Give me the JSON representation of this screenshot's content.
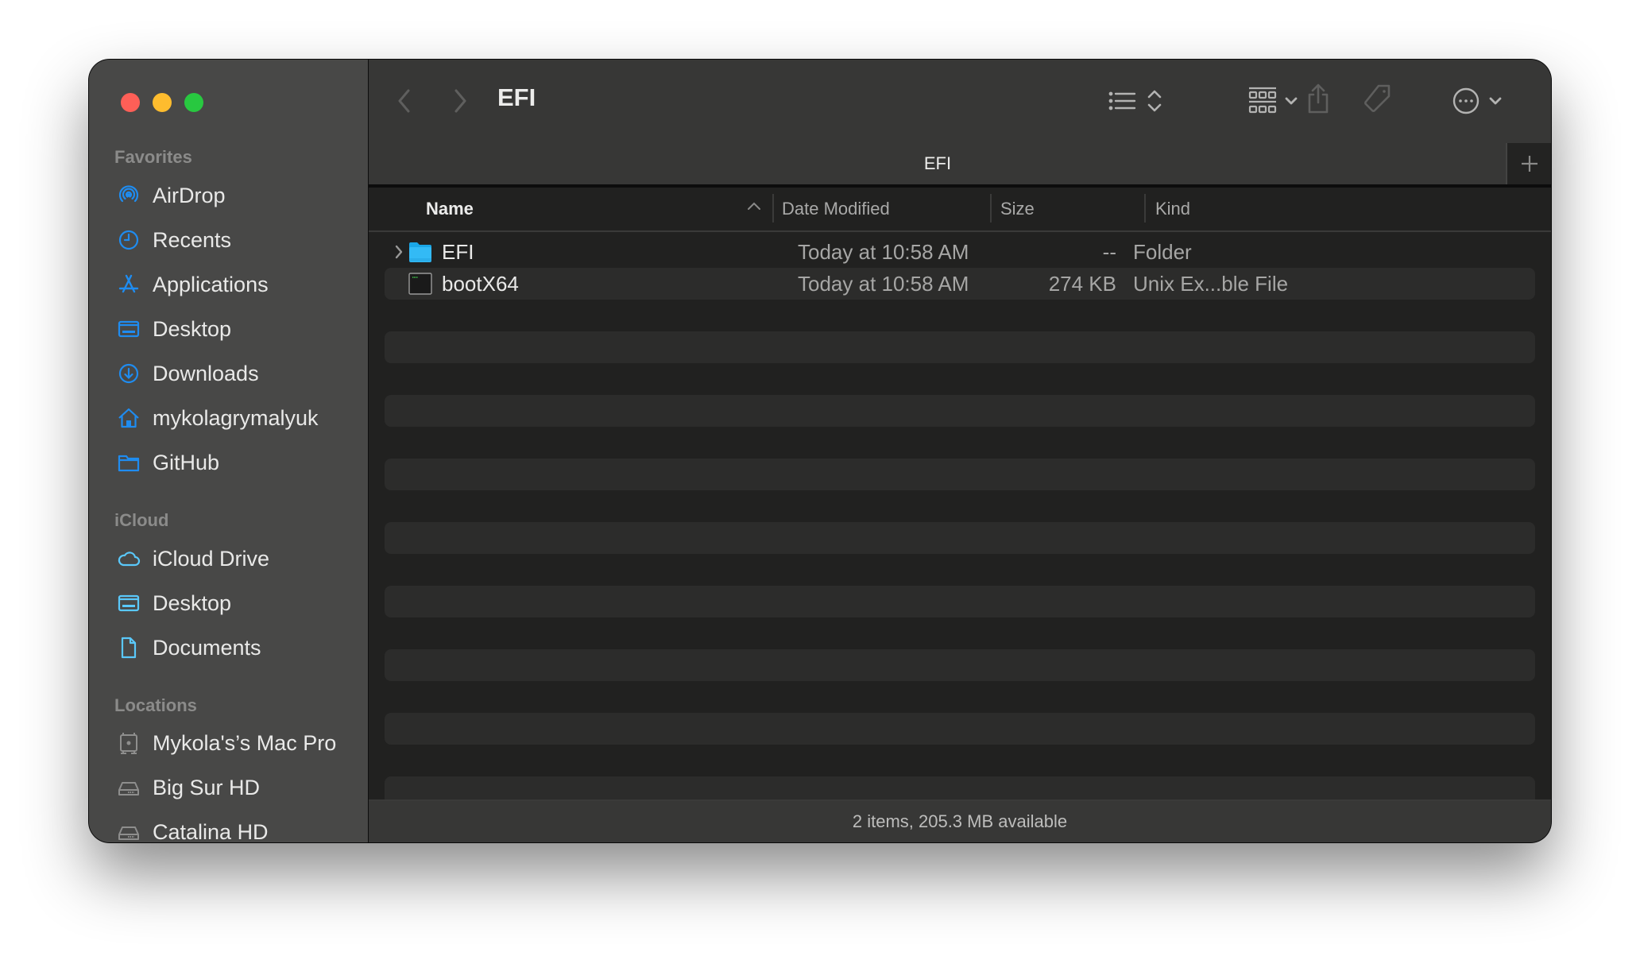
{
  "window": {
    "title": "EFI",
    "tab_title": "EFI",
    "traffic_lights": {
      "close": "#fe5f57",
      "minimize": "#febc2e",
      "zoom": "#28c840"
    }
  },
  "sidebar": {
    "sections": [
      {
        "label": "Favorites",
        "items": [
          {
            "label": "AirDrop",
            "icon": "airdrop-icon"
          },
          {
            "label": "Recents",
            "icon": "clock-icon"
          },
          {
            "label": "Applications",
            "icon": "applications-icon"
          },
          {
            "label": "Desktop",
            "icon": "desktop-icon"
          },
          {
            "label": "Downloads",
            "icon": "download-icon"
          },
          {
            "label": "mykolagrymalyuk",
            "icon": "home-icon"
          },
          {
            "label": "GitHub",
            "icon": "folder-icon"
          }
        ]
      },
      {
        "label": "iCloud",
        "items": [
          {
            "label": "iCloud Drive",
            "icon": "cloud-icon"
          },
          {
            "label": "Desktop",
            "icon": "desktop-icon"
          },
          {
            "label": "Documents",
            "icon": "document-icon"
          }
        ]
      },
      {
        "label": "Locations",
        "items": [
          {
            "label": "Mykola's’s Mac Pro",
            "icon": "mac-pro-icon"
          },
          {
            "label": "Big Sur HD",
            "icon": "drive-icon"
          },
          {
            "label": "Catalina HD",
            "icon": "drive-icon"
          }
        ]
      }
    ]
  },
  "toolbar": {
    "back": "back-icon",
    "forward": "forward-icon",
    "view_mode": "list-view-icon",
    "group": "group-icon",
    "share": "share-icon",
    "tag": "tag-icon",
    "more": "more-icon",
    "search": "search-icon",
    "accent": "#1f8cf0"
  },
  "columns": {
    "name": "Name",
    "date": "Date Modified",
    "size": "Size",
    "kind": "Kind",
    "sort": "ascending"
  },
  "files": [
    {
      "name": "EFI",
      "date": "Today at 10:58 AM",
      "size": "--",
      "kind": "Folder",
      "type": "folder",
      "expandable": true
    },
    {
      "name": "bootX64",
      "date": "Today at 10:58 AM",
      "size": "274 KB",
      "kind": "Unix Ex...ble File",
      "type": "executable",
      "expandable": false
    }
  ],
  "pathbar": {
    "label": "EFI"
  },
  "status": {
    "text": "2 items, 205.3 MB available"
  }
}
